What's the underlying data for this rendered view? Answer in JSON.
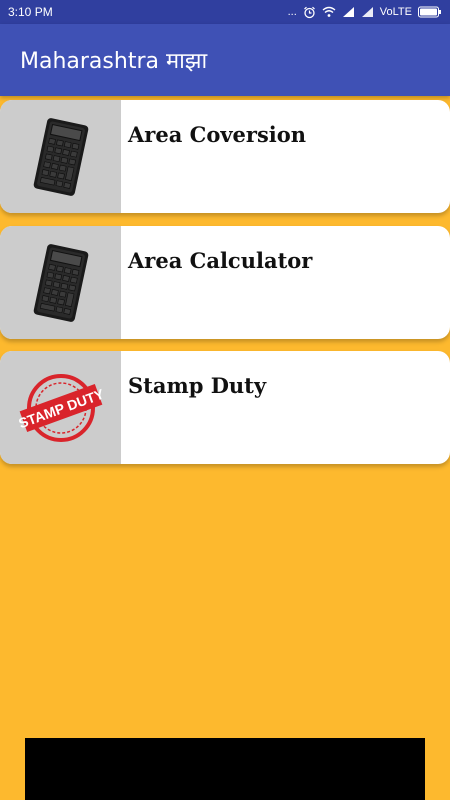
{
  "status_bar": {
    "time": "3:10 PM",
    "dots": "...",
    "network": "VoLTE",
    "icons": [
      "alarm-icon",
      "wifi-icon",
      "signal-icon",
      "signal-icon",
      "battery-icon"
    ]
  },
  "app_bar": {
    "title": "Maharashtra माझा",
    "color": "#3F51B5"
  },
  "background_color": "#FDB92E",
  "cards": [
    {
      "title": "Area Coversion",
      "icon": "calculator-icon"
    },
    {
      "title": "Area Calculator",
      "icon": "calculator-icon"
    },
    {
      "title": "Stamp Duty",
      "icon": "stamp-duty-icon",
      "stamp_text": "STAMP DUTY"
    }
  ]
}
